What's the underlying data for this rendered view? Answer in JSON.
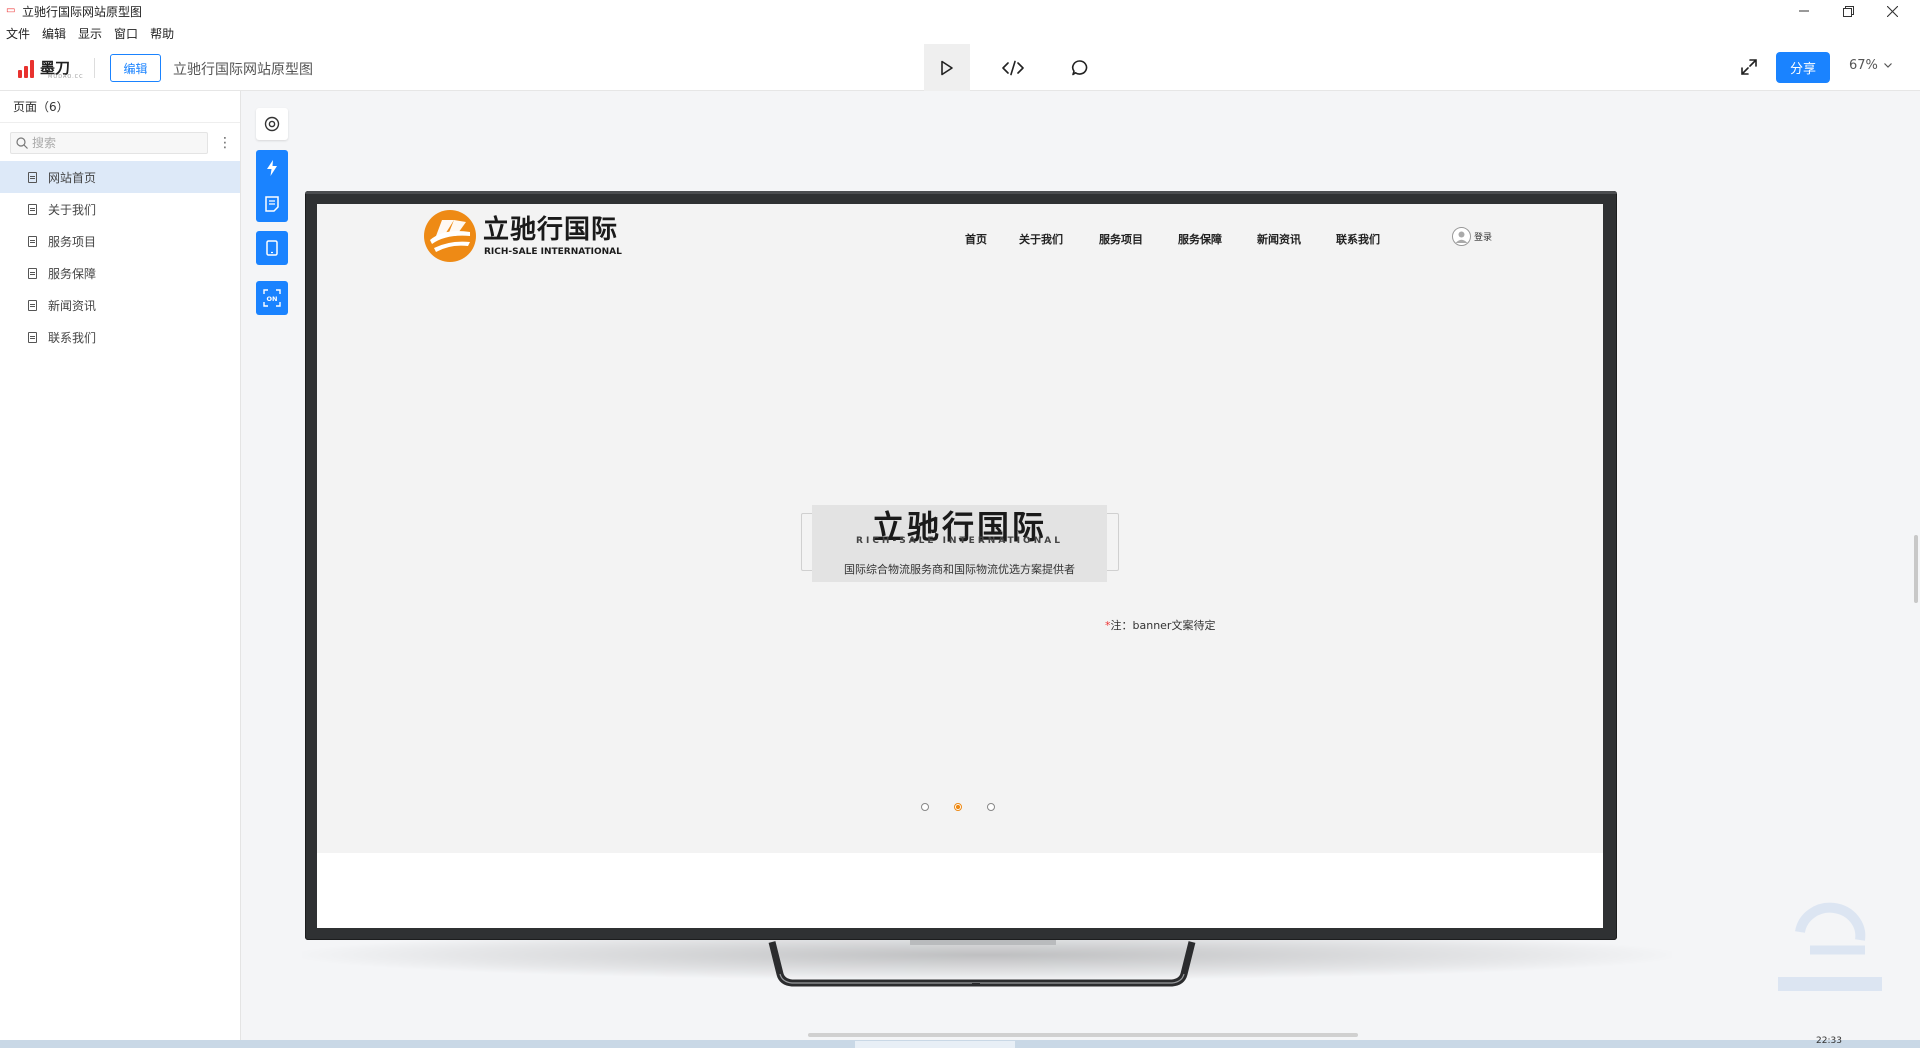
{
  "window": {
    "title": "立驰行国际网站原型图"
  },
  "menu": [
    "文件",
    "编辑",
    "显示",
    "窗口",
    "帮助"
  ],
  "toolbar": {
    "logo_name": "墨刀",
    "logo_sub": "MODAO.CC",
    "edit_label": "编辑",
    "doc_title": "立驰行国际网站原型图",
    "share_label": "分享",
    "zoom": "67%"
  },
  "sidebar": {
    "header": "页面（6）",
    "search_placeholder": "搜索",
    "pages": [
      {
        "label": "网站首页",
        "active": true
      },
      {
        "label": "关于我们"
      },
      {
        "label": "服务项目"
      },
      {
        "label": "服务保障"
      },
      {
        "label": "新闻资讯"
      },
      {
        "label": "联系我们"
      }
    ]
  },
  "site": {
    "brand_cn": "立驰行国际",
    "brand_en": "RICH-SALE INTERNATIONAL",
    "nav": [
      "首页",
      "关于我们",
      "服务项目",
      "服务保障",
      "新闻资讯",
      "联系我们"
    ],
    "login": "登录",
    "banner": {
      "title_cn": "立驰行国际",
      "title_en": "RICH-SALE INTERNATIONAL",
      "desc": "国际综合物流服务商和国际物流优选方案提供者",
      "note_star": "*",
      "note": "注：banner文案待定"
    },
    "carousel": {
      "count": 3,
      "active_index": 1
    },
    "colors": {
      "brand_orange": "#ee8a15"
    }
  },
  "taskbar": {
    "clock": "22:33"
  },
  "colors": {
    "accent": "#1a83ff",
    "page_active_bg": "#dde9f8"
  }
}
